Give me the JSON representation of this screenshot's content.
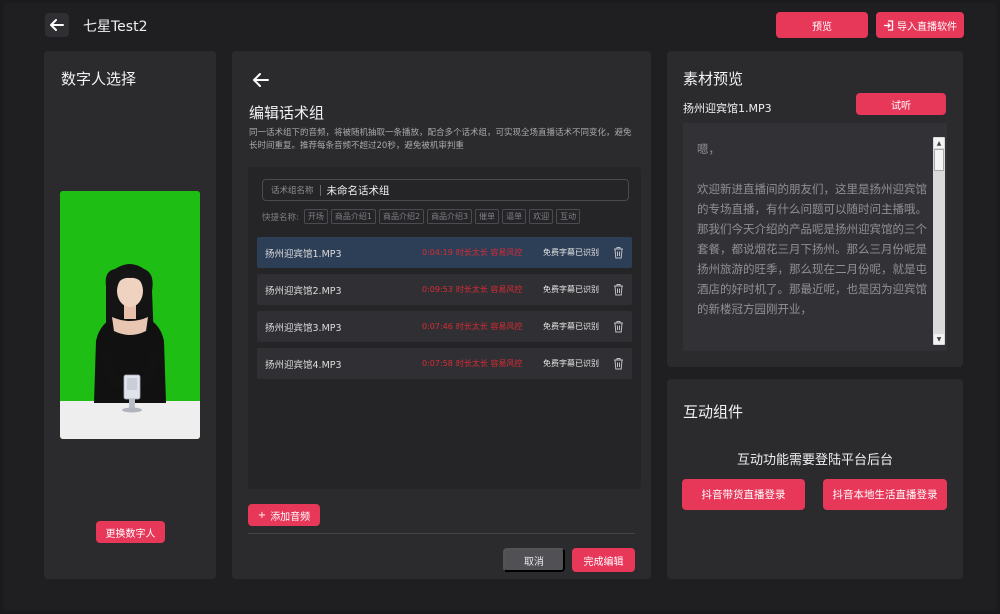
{
  "header": {
    "title": "七星Test2",
    "preview_label": "预览",
    "import_label": "导入直播软件"
  },
  "left": {
    "title": "数字人选择",
    "change_label": "更换数字人"
  },
  "center": {
    "title": "编辑话术组",
    "description": "同一话术组下的音频，将被随机抽取一条播放，配合多个话术组，可实现全场直播话术不同变化，避免长时间重复。推荐每条音频不超过20秒，避免被机审判重",
    "name_label": "话术组名称",
    "name_value": "未命名话术组",
    "quick_label": "快捷名称:",
    "quick_chips": [
      "开场",
      "商品介绍1",
      "商品介绍2",
      "商品介绍3",
      "催单",
      "逼单",
      "欢迎",
      "互动"
    ],
    "rows": [
      {
        "name": "扬州迎宾馆1.MP3",
        "duration": "0:04:19",
        "risk": "时长太长 容易风控",
        "subtitle": "免费字幕已识别"
      },
      {
        "name": "扬州迎宾馆2.MP3",
        "duration": "0:09:53",
        "risk": "时长太长 容易风控",
        "subtitle": "免费字幕已识别"
      },
      {
        "name": "扬州迎宾馆3.MP3",
        "duration": "0:07:46",
        "risk": "时长太长 容易风控",
        "subtitle": "免费字幕已识别"
      },
      {
        "name": "扬州迎宾馆4.MP3",
        "duration": "0:07:58",
        "risk": "时长太长 容易风控",
        "subtitle": "免费字幕已识别"
      }
    ],
    "add_label": "添加音频",
    "cancel_label": "取消",
    "done_label": "完成编辑"
  },
  "material": {
    "title": "素材预览",
    "file_name": "扬州迎宾馆1.MP3",
    "listen_label": "试听",
    "text": "嗯，\n\n欢迎新进直播间的朋友们，这里是扬州迎宾馆的专场直播，有什么问题可以随时问主播哦。那我们今天介绍的产品呢是扬州迎宾馆的三个套餐，都说烟花三月下扬州。那么三月份呢是扬州旅游的旺季，那么现在二月份呢，就是屯酒店的好时机了。那最近呢，也是因为迎宾馆的新楼冠方园刚开业，"
  },
  "interact": {
    "title": "互动组件",
    "message": "互动功能需要登陆平台后台",
    "login1_label": "抖音带货直播登录",
    "login2_label": "抖音本地生活直播登录"
  },
  "colors": {
    "accent": "#e8385a",
    "warning": "#d92b34",
    "selected_row": "#2d3e57",
    "green_screen": "#1fbe14"
  }
}
